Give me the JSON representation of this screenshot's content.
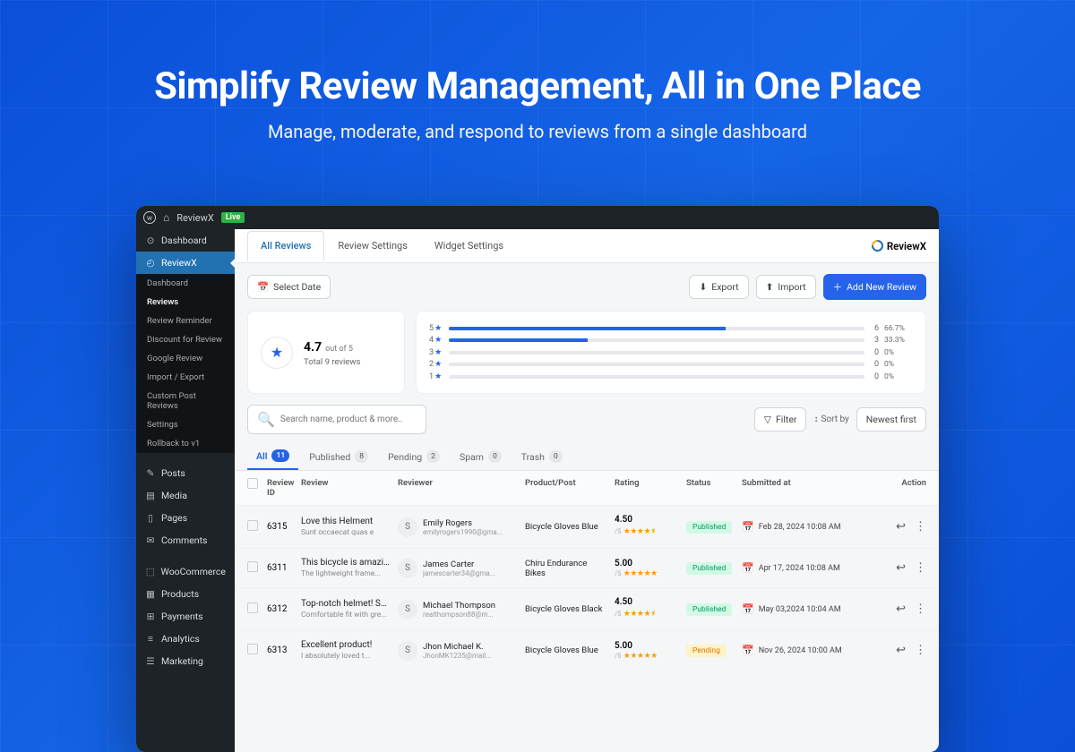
{
  "hero": {
    "title": "Simplify Review Management, All in One Place",
    "subtitle": "Manage, moderate, and respond to reviews from a single dashboard"
  },
  "titlebar": {
    "app": "ReviewX",
    "badge": "Live"
  },
  "sidebar": {
    "items": [
      {
        "icon": "⊙",
        "label": "Dashboard"
      },
      {
        "icon": "◴",
        "label": "ReviewX",
        "active": true
      }
    ],
    "subitems": [
      {
        "label": "Dashboard"
      },
      {
        "label": "Reviews",
        "active": true
      },
      {
        "label": "Review Reminder"
      },
      {
        "label": "Discount for Review"
      },
      {
        "label": "Google Review"
      },
      {
        "label": "Import / Export"
      },
      {
        "label": "Custom Post Reviews"
      },
      {
        "label": "Settings"
      },
      {
        "label": "Rollback to v1"
      }
    ],
    "items2": [
      {
        "icon": "✎",
        "label": "Posts"
      },
      {
        "icon": "▤",
        "label": "Media"
      },
      {
        "icon": "▯",
        "label": "Pages"
      },
      {
        "icon": "✉",
        "label": "Comments"
      }
    ],
    "items3": [
      {
        "icon": "⬚",
        "label": "WooCommerce"
      },
      {
        "icon": "▦",
        "label": "Products"
      },
      {
        "icon": "⊞",
        "label": "Payments"
      },
      {
        "icon": "≡",
        "label": "Analytics"
      },
      {
        "icon": "☰",
        "label": "Marketing"
      }
    ]
  },
  "tabs": [
    {
      "label": "All Reviews",
      "active": true
    },
    {
      "label": "Review Settings"
    },
    {
      "label": "Widget Settings"
    }
  ],
  "brand": "ReviewX",
  "toolbar": {
    "select_date": "Select Date",
    "export": "Export",
    "import": "Import",
    "add_new": "Add New Review"
  },
  "summary": {
    "score": "4.7",
    "outof": "out of 5",
    "total": "Total 9 reviews"
  },
  "bars": [
    {
      "star": "5",
      "count": "6",
      "pct": "66.7%",
      "fill": 66.7
    },
    {
      "star": "4",
      "count": "3",
      "pct": "33.3%",
      "fill": 33.3
    },
    {
      "star": "3",
      "count": "0",
      "pct": "0%",
      "fill": 0
    },
    {
      "star": "2",
      "count": "0",
      "pct": "0%",
      "fill": 0
    },
    {
      "star": "1",
      "count": "0",
      "pct": "0%",
      "fill": 0
    }
  ],
  "search": {
    "placeholder": "Search name, product & more.."
  },
  "filter": "Filter",
  "sortby": "Sort by",
  "newest": "Newest first",
  "status_tabs": [
    {
      "label": "All",
      "count": "11",
      "active": true
    },
    {
      "label": "Published",
      "count": "8"
    },
    {
      "label": "Pending",
      "count": "2"
    },
    {
      "label": "Spam",
      "count": "0"
    },
    {
      "label": "Trash",
      "count": "0"
    }
  ],
  "columns": {
    "id": "Review ID",
    "review": "Review",
    "reviewer": "Reviewer",
    "product": "Product/Post",
    "rating": "Rating",
    "status": "Status",
    "submitted": "Submitted at",
    "action": "Action"
  },
  "rows": [
    {
      "id": "6315",
      "title": "Love this Helment",
      "body": "Sunt occaecat quas e",
      "initial": "S",
      "name": "Emily Rogers",
      "email": "emilyrogers1990@gma...",
      "product": "Bicycle Gloves Blue",
      "rating": "4.50",
      "stars": "★★★★⯨",
      "status": "Published",
      "status_class": "published",
      "date": "Feb 28, 2024 10:08 AM"
    },
    {
      "id": "6311",
      "title": "This bicycle is amazing!",
      "body": "The lightweight frame...",
      "initial": "S",
      "name": "James Carter",
      "email": "jamescarter34@gma...",
      "product": "Chiru Endurance Bikes",
      "rating": "5.00",
      "stars": "★★★★★",
      "status": "Published",
      "status_class": "published",
      "date": "Apr 17,  2024 10:08 AM"
    },
    {
      "id": "6312",
      "title": "Top-notch helmet! Saf...",
      "body": "Comfortable fit with gre...",
      "initial": "S",
      "name": "Michael Thompson",
      "email": "realthompson88@m...",
      "product": "Bicycle Gloves Black",
      "rating": "4.50",
      "stars": "★★★★⯨",
      "status": "Published",
      "status_class": "published",
      "date": "May 03,2024 10:04 AM"
    },
    {
      "id": "6313",
      "title": "Excellent product!",
      "body": "I absolutely loved t...",
      "initial": "S",
      "name": "Jhon Michael K.",
      "email": "JhonMK1235@mail...",
      "product": "Bicycle Gloves Blue",
      "rating": "5.00",
      "stars": "★★★★★",
      "status": "Pending",
      "status_class": "pending",
      "date": "Nov 26, 2024 10:00 AM"
    }
  ]
}
